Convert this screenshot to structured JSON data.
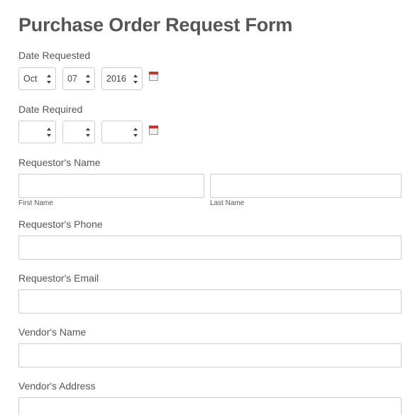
{
  "form": {
    "title": "Purchase Order Request Form",
    "date_requested": {
      "label": "Date Requested",
      "month": "Oct",
      "day": "07",
      "year": "2016"
    },
    "date_required": {
      "label": "Date Required",
      "month": "",
      "day": "",
      "year": ""
    },
    "requestor_name": {
      "label": "Requestor's Name",
      "first_label": "First Name",
      "last_label": "Last Name"
    },
    "requestor_phone": {
      "label": "Requestor's Phone"
    },
    "requestor_email": {
      "label": "Requestor's Email"
    },
    "vendor_name": {
      "label": "Vendor's Name"
    },
    "vendor_address": {
      "label": "Vendor's Address"
    }
  },
  "icons": {
    "calendar": "calendar-icon",
    "select_arrows": "select-arrows-icon"
  },
  "colors": {
    "text": "#555555",
    "border": "#cccccc",
    "calendar_accent": "#c0392b"
  }
}
